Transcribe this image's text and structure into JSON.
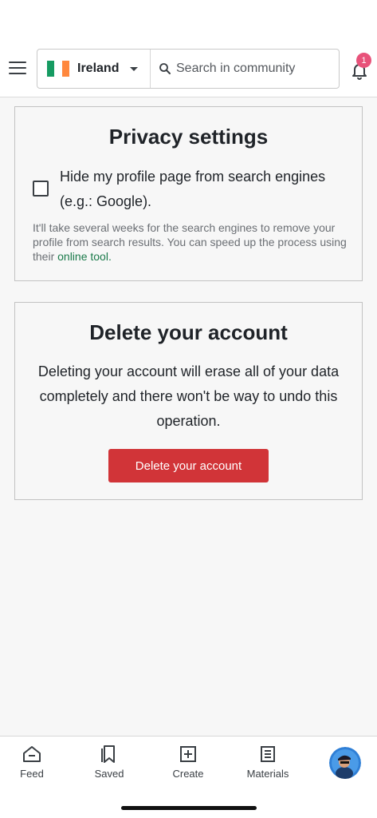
{
  "topbar": {
    "country": "Ireland",
    "flag_colors": [
      "#169b62",
      "#ffffff",
      "#ff883e"
    ],
    "search_placeholder": "Search in community",
    "notification_count": "1"
  },
  "privacy": {
    "title": "Privacy settings",
    "checkbox_label": "Hide my profile page from search engines (e.g.: Google).",
    "checkbox_checked": false,
    "note_text": "It'll take several weeks for the search engines to remove your profile from search results. You can speed up the process using their ",
    "note_link": "online tool."
  },
  "delete_account": {
    "title": "Delete your account",
    "description": "Deleting your account will erase all of your data completely and there won't be way to undo this operation.",
    "button_label": "Delete your account",
    "button_color": "#d13438"
  },
  "bottom_nav": {
    "items": [
      {
        "label": "Feed",
        "icon": "home-icon"
      },
      {
        "label": "Saved",
        "icon": "bookmark-icon"
      },
      {
        "label": "Create",
        "icon": "plus-square-icon"
      },
      {
        "label": "Materials",
        "icon": "document-icon"
      }
    ],
    "avatar_icon": "profile-avatar"
  },
  "colors": {
    "accent_link": "#1a7a4a",
    "badge": "#e8527a",
    "background": "#f7f7f7"
  }
}
